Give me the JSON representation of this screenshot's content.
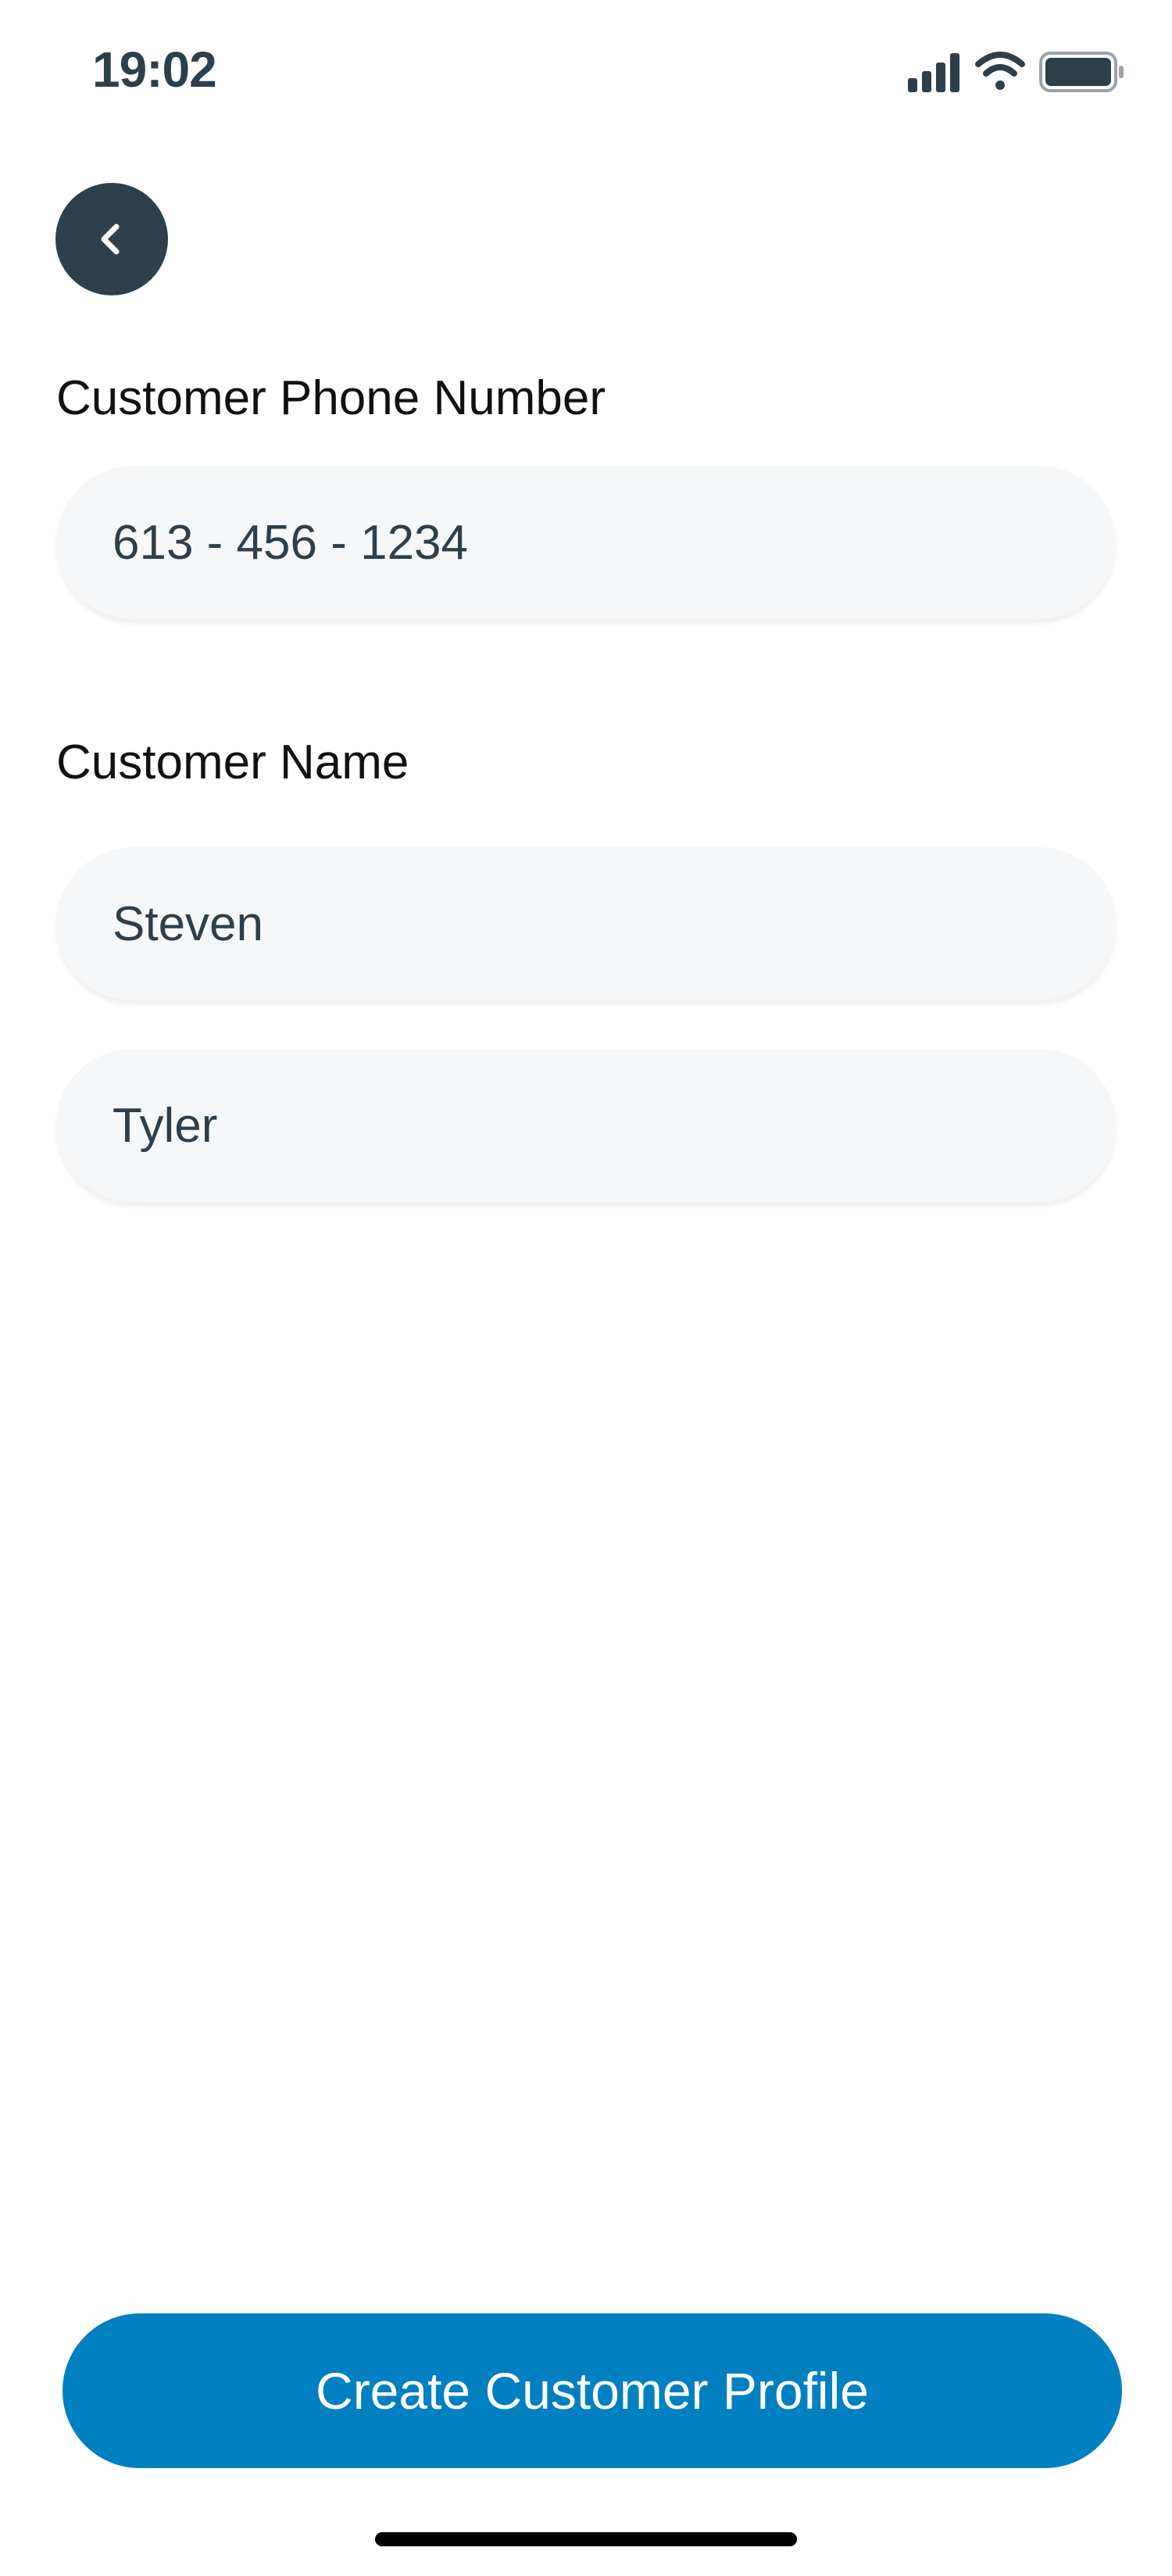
{
  "status_bar": {
    "time": "19:02",
    "icons": [
      "cellular-signal-icon",
      "wifi-icon",
      "battery-icon"
    ]
  },
  "nav": {
    "back_icon": "chevron-left-icon"
  },
  "form": {
    "phone": {
      "label": "Customer Phone Number",
      "value": "613 - 456 - 1234"
    },
    "name": {
      "label": "Customer Name",
      "first_value": "Steven",
      "last_value": "Tyler"
    }
  },
  "actions": {
    "create_label": "Create Customer Profile"
  },
  "colors": {
    "primary": "#0080c0",
    "dark": "#2d404b",
    "field_bg": "#f6f7f9"
  }
}
